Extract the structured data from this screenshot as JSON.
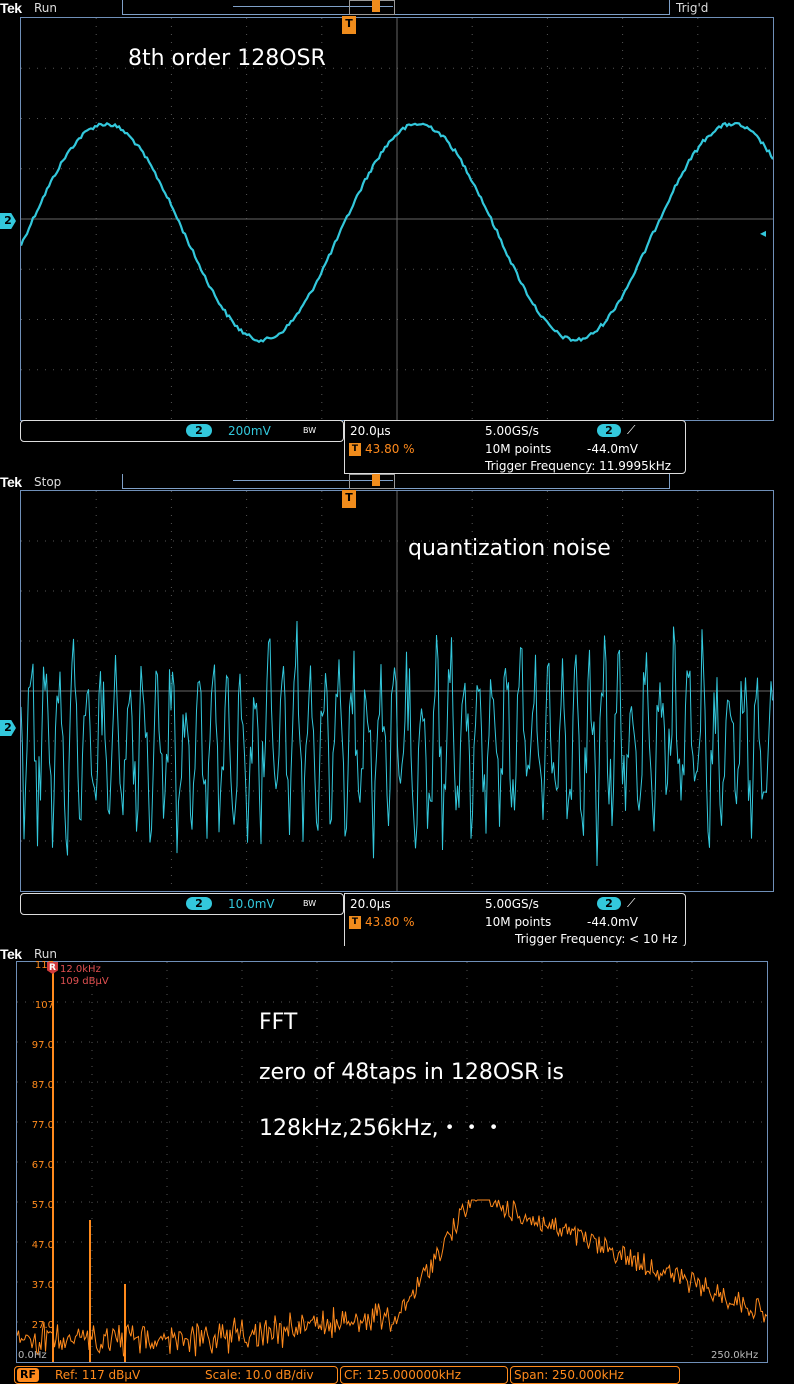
{
  "scope1": {
    "brand": "Tek",
    "state": "Run",
    "trigger_status": "Trig'd",
    "annotation": "8th order 128OSR",
    "channel": "2",
    "vertical_scale": "200mV",
    "bw_icon": "bandwidth-limit-icon",
    "timebase": "20.0µs",
    "trigger_pos": "43.80 %",
    "sample_rate": "5.00GS/s",
    "record_length": "10M points",
    "trigger_channel": "2",
    "trigger_level": "-44.0mV",
    "trigger_frequency": "Trigger Frequency: 11.9995kHz",
    "trace_color": "#33c8dc"
  },
  "scope2": {
    "brand": "Tek",
    "state": "Stop",
    "annotation": "quantization noise",
    "channel": "2",
    "vertical_scale": "10.0mV",
    "timebase": "20.0µs",
    "trigger_pos": "43.80 %",
    "sample_rate": "5.00GS/s",
    "record_length": "10M points",
    "trigger_channel": "2",
    "trigger_level": "-44.0mV",
    "trigger_frequency": "Trigger Frequency: < 10 Hz"
  },
  "scope3": {
    "brand": "Tek",
    "state": "Run",
    "annotation_lines": [
      "FFT",
      "zero of 48taps in 128OSR is",
      "128kHz,256kHz,・・・"
    ],
    "marker_label": "R",
    "marker_freq": "12.0kHz",
    "marker_level": "109 dBµV",
    "y_labels": [
      "117",
      "107",
      "97.0",
      "87.0",
      "77.0",
      "67.0",
      "57.0",
      "47.0",
      "37.0",
      "27.0"
    ],
    "x_start": "0.0Hz",
    "x_end": "250.0kHz",
    "rf_badge": "RF",
    "ref_level": "Ref: 117 dBµV",
    "scale": "Scale: 10.0 dB/div",
    "center_freq": "CF:  125.000000kHz",
    "span": "Span:   250.000kHz",
    "trace_color": "#ff8a1c"
  }
}
